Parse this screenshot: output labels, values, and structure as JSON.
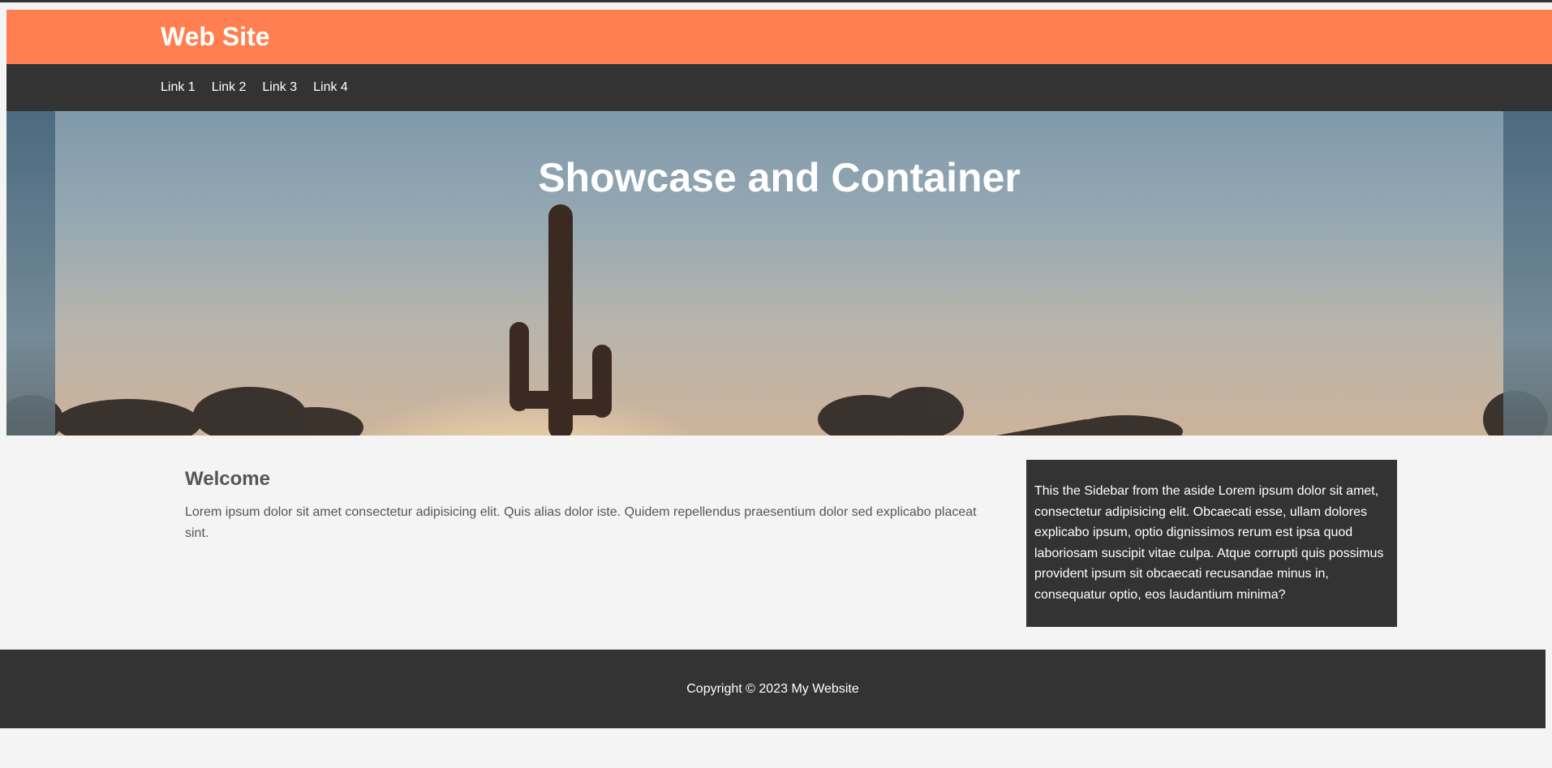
{
  "header": {
    "brand": "Web Site"
  },
  "nav": {
    "links": [
      {
        "label": "Link 1"
      },
      {
        "label": "Link 2"
      },
      {
        "label": "Link 3"
      },
      {
        "label": "Link 4"
      }
    ]
  },
  "showcase": {
    "title": "Showcase and Container"
  },
  "main": {
    "heading": "Welcome",
    "body": "Lorem ipsum dolor sit amet consectetur adipisicing elit. Quis alias dolor iste. Quidem repellendus praesentium dolor sed explicabo placeat sint."
  },
  "sidebar": {
    "text": "This the Sidebar from the aside Lorem ipsum dolor sit amet, consectetur adipisicing elit. Obcaecati esse, ullam dolores explicabo ipsum, optio dignissimos rerum est ipsa quod laboriosam suscipit vitae culpa. Atque corrupti quis possimus provident ipsum sit obcaecati recusandae minus in, consequatur optio, eos laudantium minima?"
  },
  "footer": {
    "copyright": "Copyright © 2023 My Website"
  },
  "colors": {
    "header_bg": "#ff7f50",
    "nav_bg": "#333333",
    "page_bg": "#f4f4f4",
    "text": "#555555"
  }
}
